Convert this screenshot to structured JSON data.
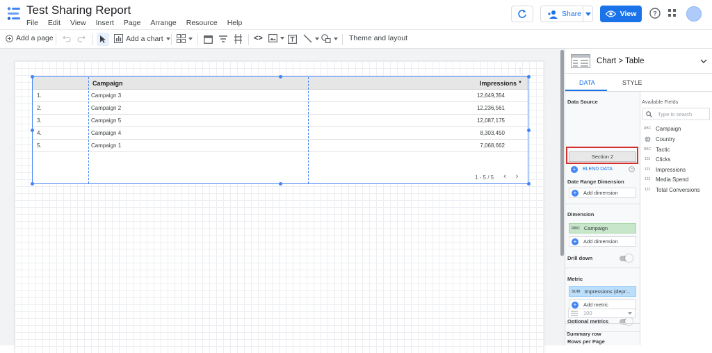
{
  "app": {
    "title": "Test Sharing Report",
    "menus": [
      "File",
      "Edit",
      "View",
      "Insert",
      "Page",
      "Arrange",
      "Resource",
      "Help"
    ],
    "share_label": "Share",
    "view_label": "View"
  },
  "toolbar": {
    "add_page": "Add a page",
    "add_chart": "Add a chart",
    "theme_layout": "Theme and layout"
  },
  "table": {
    "headers": {
      "dimension": "Campaign",
      "metric": "Impressions",
      "sort_indicator": "▼"
    },
    "rows": [
      {
        "index": "1.",
        "campaign": "Campaign 3",
        "impressions": "12,649,354"
      },
      {
        "index": "2.",
        "campaign": "Campaign 2",
        "impressions": "12,236,561"
      },
      {
        "index": "3.",
        "campaign": "Campaign 5",
        "impressions": "12,087,175"
      },
      {
        "index": "4.",
        "campaign": "Campaign 4",
        "impressions": "8,303,450"
      },
      {
        "index": "5.",
        "campaign": "Campaign 1",
        "impressions": "7,068,662"
      }
    ],
    "pagination": "1 - 5 / 5"
  },
  "panel": {
    "breadcrumb": "Chart > Table",
    "tabs": {
      "data": "DATA",
      "style": "STYLE"
    },
    "data_source_label": "Data Source",
    "data_source_value": "Section 2",
    "blend_data": "BLEND DATA",
    "date_range_label": "Date Range Dimension",
    "add_dimension": "Add dimension",
    "dimension_label": "Dimension",
    "dimension_value": "Campaign",
    "dimension_tag": "RBC",
    "drill_down": "Drill down",
    "metric_label": "Metric",
    "metric_tag": "SUM",
    "metric_value": "Impressions (depr...",
    "add_metric": "Add metric",
    "optional_metrics": "Optional metrics",
    "rows_per_page_label": "Rows per Page",
    "rows_per_page_value": "100",
    "summary_row": "Summary row",
    "available_fields_title": "Available Fields",
    "search_placeholder": "Type to search",
    "fields": [
      {
        "type": "RBC",
        "name": "Campaign"
      },
      {
        "type": "globe",
        "name": "Country"
      },
      {
        "type": "RBC",
        "name": "Tactic"
      },
      {
        "type": "123",
        "name": "Clicks"
      },
      {
        "type": "123",
        "name": "Impressions"
      },
      {
        "type": "123",
        "name": "Media Spend"
      },
      {
        "type": "123",
        "name": "Total Conversions"
      }
    ]
  },
  "colors": {
    "accent": "#1a73e8",
    "highlight_border": "#d32f2f",
    "dimension_chip": "#c8e6c9",
    "metric_chip": "#bbdefb"
  }
}
